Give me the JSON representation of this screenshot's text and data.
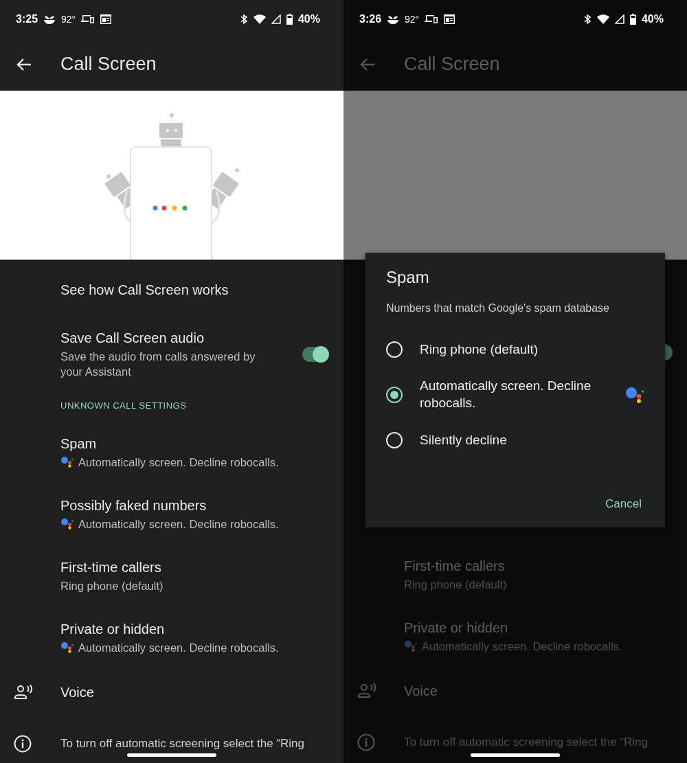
{
  "screens": [
    {
      "dimmed": false,
      "status_bar": {
        "time": "3:25",
        "temperature": "92°",
        "battery": "40%"
      },
      "app_bar": {
        "title": "Call Screen"
      },
      "banner": {
        "kind": "illustration"
      },
      "rows": [
        {
          "kind": "link",
          "title": "See how Call Screen works"
        },
        {
          "kind": "toggle",
          "title": "Save Call Screen audio",
          "subtitle": "Save the audio from calls answered by your Assistant",
          "on": true
        },
        {
          "kind": "header",
          "title": "UNKNOWN CALL SETTINGS"
        },
        {
          "kind": "choice",
          "title": "Spam",
          "subtitle": "Automatically screen. Decline robocalls.",
          "assistant_icon": true
        },
        {
          "kind": "choice",
          "title": "Possibly faked numbers",
          "subtitle": "Automatically screen. Decline robocalls.",
          "assistant_icon": true
        },
        {
          "kind": "choice",
          "title": "First-time callers",
          "subtitle": "Ring phone (default)",
          "assistant_icon": false
        },
        {
          "kind": "choice",
          "title": "Private or hidden",
          "subtitle": "Automatically screen. Decline robocalls.",
          "assistant_icon": true
        },
        {
          "kind": "voice",
          "title": "Voice"
        },
        {
          "kind": "note",
          "text": "To turn off automatic screening select the “Ring"
        }
      ]
    },
    {
      "dimmed": true,
      "status_bar": {
        "time": "3:26",
        "temperature": "92°",
        "battery": "40%"
      },
      "app_bar": {
        "title": "Call Screen"
      },
      "banner": {
        "kind": "blank"
      },
      "covered_toggle": {
        "on": true
      },
      "dialog": {
        "title": "Spam",
        "description": "Numbers that match Google's spam database",
        "options": [
          {
            "label": "Ring phone (default)",
            "selected": false,
            "assistant_icon": false
          },
          {
            "label": "Automatically screen. Decline robocalls.",
            "selected": true,
            "assistant_icon": true
          },
          {
            "label": "Silently decline",
            "selected": false,
            "assistant_icon": false
          }
        ],
        "button": "Cancel"
      },
      "rows": [
        {
          "kind": "choice",
          "title": "First-time callers",
          "subtitle": "Ring phone (default)",
          "assistant_icon": false
        },
        {
          "kind": "choice",
          "title": "Private or hidden",
          "subtitle": "Automatically screen. Decline robocalls.",
          "assistant_icon": true
        },
        {
          "kind": "voice",
          "title": "Voice"
        },
        {
          "kind": "note",
          "text": "To turn off automatic screening select the “Ring"
        }
      ]
    }
  ]
}
